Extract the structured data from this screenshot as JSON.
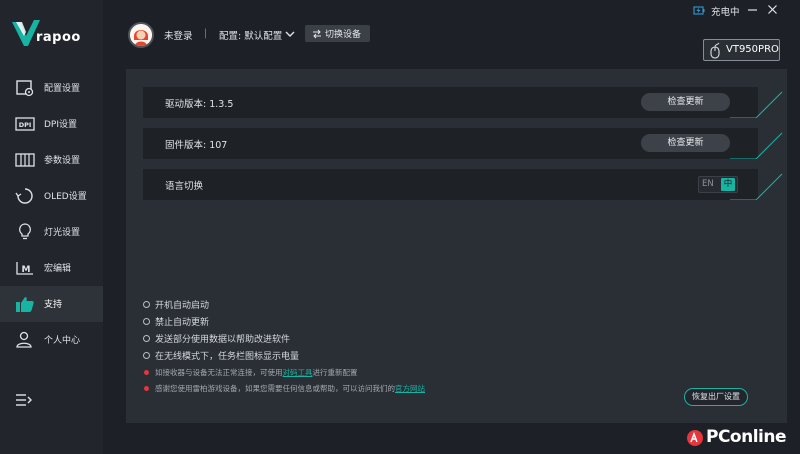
{
  "brand": {
    "name": "rapoo"
  },
  "sidebar": {
    "items": [
      {
        "label": "配置设置",
        "icon": "config-icon"
      },
      {
        "label": "DPI设置",
        "icon": "dpi-icon"
      },
      {
        "label": "参数设置",
        "icon": "parameters-icon"
      },
      {
        "label": "OLED设置",
        "icon": "oled-icon"
      },
      {
        "label": "灯光设置",
        "icon": "lightbulb-icon"
      },
      {
        "label": "宏编辑",
        "icon": "macro-icon"
      },
      {
        "label": "支持",
        "icon": "thumbs-up-icon",
        "active": true
      },
      {
        "label": "个人中心",
        "icon": "user-icon"
      }
    ]
  },
  "header": {
    "user": "未登录",
    "separator": "|",
    "profile": "配置: 默认配置",
    "switch_device": "切换设备",
    "charging": "充电中",
    "device": "VT950PRO"
  },
  "main": {
    "driver_version": {
      "label": "驱动版本: 1.3.5",
      "button": "检查更新"
    },
    "firmware_version": {
      "label": "固件版本: 107",
      "button": "检查更新"
    },
    "language": {
      "label": "语言切换",
      "en": "EN",
      "zh": "中",
      "selected": "中"
    },
    "options": [
      "开机自动启动",
      "禁止自动更新",
      "发送部分使用数据以帮助改进软件",
      "在无线模式下，任务栏图标显示电量"
    ],
    "notes": [
      {
        "before": "如接收器与设备无法正常连接，可使用",
        "link": "对码工具",
        "after": "进行重新配置"
      },
      {
        "before": "感谢您使用雷柏游戏设备，如果您需要任何信息或帮助，可以访问我们的",
        "link": "官方网站",
        "after": ""
      }
    ],
    "reset_button": "恢复出厂设置"
  },
  "watermark": "PConline",
  "colors": {
    "accent": "#17b3a3",
    "bullet": "#e5353d",
    "background": "#1d2127",
    "panel": "#2a2f35"
  }
}
